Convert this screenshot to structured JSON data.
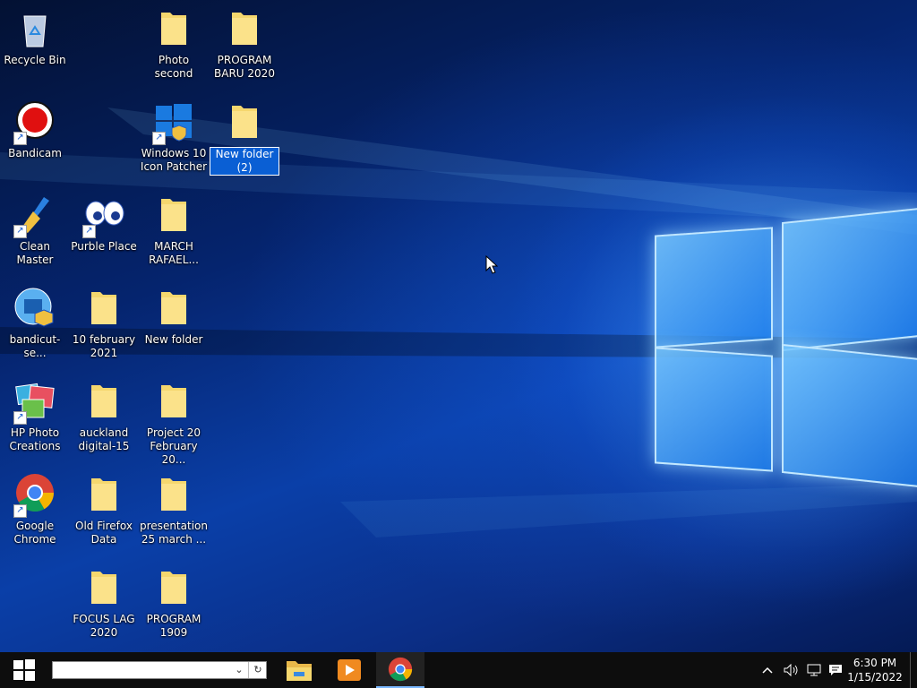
{
  "desktop": {
    "icons": [
      {
        "id": "recycle-bin",
        "label": "Recycle Bin"
      },
      {
        "id": "bandicam",
        "label": "Bandicam"
      },
      {
        "id": "clean-master",
        "label": "Clean Master"
      },
      {
        "id": "bandicut",
        "label": "bandicut-se..."
      },
      {
        "id": "hp-photo",
        "label": "HP Photo Creations"
      },
      {
        "id": "google-chrome",
        "label": "Google Chrome"
      },
      {
        "id": "purble-place",
        "label": "Purble Place"
      },
      {
        "id": "10-february",
        "label": "10 february 2021"
      },
      {
        "id": "auckland",
        "label": "auckland digital-15"
      },
      {
        "id": "old-firefox",
        "label": "Old Firefox Data"
      },
      {
        "id": "focus-lag",
        "label": "FOCUS LAG 2020"
      },
      {
        "id": "photo-second",
        "label": "Photo second"
      },
      {
        "id": "win10-patcher",
        "label": "Windows 10 Icon Patcher"
      },
      {
        "id": "march-rafael",
        "label": "MARCH RAFAEL..."
      },
      {
        "id": "new-folder",
        "label": "New folder"
      },
      {
        "id": "project-20",
        "label": "Project 20 February 20..."
      },
      {
        "id": "presentation",
        "label": "presentation 25 march ..."
      },
      {
        "id": "program-1909",
        "label": "PROGRAM 1909"
      },
      {
        "id": "program-baru",
        "label": "PROGRAM BARU 2020"
      },
      {
        "id": "new-folder-2",
        "label": "New folder (2)"
      }
    ]
  },
  "taskbar": {
    "search_value": "",
    "clock_time": "6:30 PM",
    "clock_date": "1/15/2022"
  },
  "colors": {
    "taskbar": "#0d0d0d",
    "selection": "#0a5fd4",
    "folder": "#f5d76e"
  }
}
